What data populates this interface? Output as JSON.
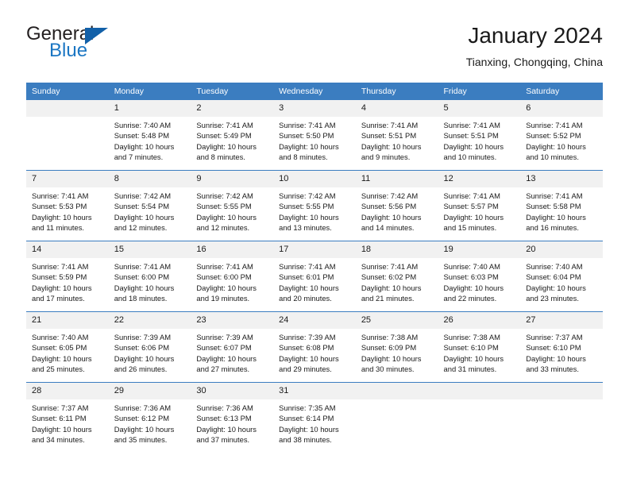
{
  "brand": {
    "name_part1": "General",
    "name_part2": "Blue",
    "triangle_color": "#1260a8",
    "blue_color": "#1b76c3"
  },
  "header": {
    "title": "January 2024",
    "subtitle": "Tianxing, Chongqing, China"
  },
  "theme": {
    "header_bg": "#3b7dc0",
    "header_text": "#ffffff",
    "daynum_bg": "#f1f1f1",
    "grid_line": "#3b7dc0",
    "body_text": "#1a1a1a"
  },
  "weekdays": [
    "Sunday",
    "Monday",
    "Tuesday",
    "Wednesday",
    "Thursday",
    "Friday",
    "Saturday"
  ],
  "weeks": [
    [
      {
        "day": "",
        "sunrise": "",
        "sunset": "",
        "daylight_line1": "",
        "daylight_line2": "",
        "empty": true
      },
      {
        "day": "1",
        "sunrise": "Sunrise: 7:40 AM",
        "sunset": "Sunset: 5:48 PM",
        "daylight_line1": "Daylight: 10 hours",
        "daylight_line2": "and 7 minutes."
      },
      {
        "day": "2",
        "sunrise": "Sunrise: 7:41 AM",
        "sunset": "Sunset: 5:49 PM",
        "daylight_line1": "Daylight: 10 hours",
        "daylight_line2": "and 8 minutes."
      },
      {
        "day": "3",
        "sunrise": "Sunrise: 7:41 AM",
        "sunset": "Sunset: 5:50 PM",
        "daylight_line1": "Daylight: 10 hours",
        "daylight_line2": "and 8 minutes."
      },
      {
        "day": "4",
        "sunrise": "Sunrise: 7:41 AM",
        "sunset": "Sunset: 5:51 PM",
        "daylight_line1": "Daylight: 10 hours",
        "daylight_line2": "and 9 minutes."
      },
      {
        "day": "5",
        "sunrise": "Sunrise: 7:41 AM",
        "sunset": "Sunset: 5:51 PM",
        "daylight_line1": "Daylight: 10 hours",
        "daylight_line2": "and 10 minutes."
      },
      {
        "day": "6",
        "sunrise": "Sunrise: 7:41 AM",
        "sunset": "Sunset: 5:52 PM",
        "daylight_line1": "Daylight: 10 hours",
        "daylight_line2": "and 10 minutes."
      }
    ],
    [
      {
        "day": "7",
        "sunrise": "Sunrise: 7:41 AM",
        "sunset": "Sunset: 5:53 PM",
        "daylight_line1": "Daylight: 10 hours",
        "daylight_line2": "and 11 minutes."
      },
      {
        "day": "8",
        "sunrise": "Sunrise: 7:42 AM",
        "sunset": "Sunset: 5:54 PM",
        "daylight_line1": "Daylight: 10 hours",
        "daylight_line2": "and 12 minutes."
      },
      {
        "day": "9",
        "sunrise": "Sunrise: 7:42 AM",
        "sunset": "Sunset: 5:55 PM",
        "daylight_line1": "Daylight: 10 hours",
        "daylight_line2": "and 12 minutes."
      },
      {
        "day": "10",
        "sunrise": "Sunrise: 7:42 AM",
        "sunset": "Sunset: 5:55 PM",
        "daylight_line1": "Daylight: 10 hours",
        "daylight_line2": "and 13 minutes."
      },
      {
        "day": "11",
        "sunrise": "Sunrise: 7:42 AM",
        "sunset": "Sunset: 5:56 PM",
        "daylight_line1": "Daylight: 10 hours",
        "daylight_line2": "and 14 minutes."
      },
      {
        "day": "12",
        "sunrise": "Sunrise: 7:41 AM",
        "sunset": "Sunset: 5:57 PM",
        "daylight_line1": "Daylight: 10 hours",
        "daylight_line2": "and 15 minutes."
      },
      {
        "day": "13",
        "sunrise": "Sunrise: 7:41 AM",
        "sunset": "Sunset: 5:58 PM",
        "daylight_line1": "Daylight: 10 hours",
        "daylight_line2": "and 16 minutes."
      }
    ],
    [
      {
        "day": "14",
        "sunrise": "Sunrise: 7:41 AM",
        "sunset": "Sunset: 5:59 PM",
        "daylight_line1": "Daylight: 10 hours",
        "daylight_line2": "and 17 minutes."
      },
      {
        "day": "15",
        "sunrise": "Sunrise: 7:41 AM",
        "sunset": "Sunset: 6:00 PM",
        "daylight_line1": "Daylight: 10 hours",
        "daylight_line2": "and 18 minutes."
      },
      {
        "day": "16",
        "sunrise": "Sunrise: 7:41 AM",
        "sunset": "Sunset: 6:00 PM",
        "daylight_line1": "Daylight: 10 hours",
        "daylight_line2": "and 19 minutes."
      },
      {
        "day": "17",
        "sunrise": "Sunrise: 7:41 AM",
        "sunset": "Sunset: 6:01 PM",
        "daylight_line1": "Daylight: 10 hours",
        "daylight_line2": "and 20 minutes."
      },
      {
        "day": "18",
        "sunrise": "Sunrise: 7:41 AM",
        "sunset": "Sunset: 6:02 PM",
        "daylight_line1": "Daylight: 10 hours",
        "daylight_line2": "and 21 minutes."
      },
      {
        "day": "19",
        "sunrise": "Sunrise: 7:40 AM",
        "sunset": "Sunset: 6:03 PM",
        "daylight_line1": "Daylight: 10 hours",
        "daylight_line2": "and 22 minutes."
      },
      {
        "day": "20",
        "sunrise": "Sunrise: 7:40 AM",
        "sunset": "Sunset: 6:04 PM",
        "daylight_line1": "Daylight: 10 hours",
        "daylight_line2": "and 23 minutes."
      }
    ],
    [
      {
        "day": "21",
        "sunrise": "Sunrise: 7:40 AM",
        "sunset": "Sunset: 6:05 PM",
        "daylight_line1": "Daylight: 10 hours",
        "daylight_line2": "and 25 minutes."
      },
      {
        "day": "22",
        "sunrise": "Sunrise: 7:39 AM",
        "sunset": "Sunset: 6:06 PM",
        "daylight_line1": "Daylight: 10 hours",
        "daylight_line2": "and 26 minutes."
      },
      {
        "day": "23",
        "sunrise": "Sunrise: 7:39 AM",
        "sunset": "Sunset: 6:07 PM",
        "daylight_line1": "Daylight: 10 hours",
        "daylight_line2": "and 27 minutes."
      },
      {
        "day": "24",
        "sunrise": "Sunrise: 7:39 AM",
        "sunset": "Sunset: 6:08 PM",
        "daylight_line1": "Daylight: 10 hours",
        "daylight_line2": "and 29 minutes."
      },
      {
        "day": "25",
        "sunrise": "Sunrise: 7:38 AM",
        "sunset": "Sunset: 6:09 PM",
        "daylight_line1": "Daylight: 10 hours",
        "daylight_line2": "and 30 minutes."
      },
      {
        "day": "26",
        "sunrise": "Sunrise: 7:38 AM",
        "sunset": "Sunset: 6:10 PM",
        "daylight_line1": "Daylight: 10 hours",
        "daylight_line2": "and 31 minutes."
      },
      {
        "day": "27",
        "sunrise": "Sunrise: 7:37 AM",
        "sunset": "Sunset: 6:10 PM",
        "daylight_line1": "Daylight: 10 hours",
        "daylight_line2": "and 33 minutes."
      }
    ],
    [
      {
        "day": "28",
        "sunrise": "Sunrise: 7:37 AM",
        "sunset": "Sunset: 6:11 PM",
        "daylight_line1": "Daylight: 10 hours",
        "daylight_line2": "and 34 minutes."
      },
      {
        "day": "29",
        "sunrise": "Sunrise: 7:36 AM",
        "sunset": "Sunset: 6:12 PM",
        "daylight_line1": "Daylight: 10 hours",
        "daylight_line2": "and 35 minutes."
      },
      {
        "day": "30",
        "sunrise": "Sunrise: 7:36 AM",
        "sunset": "Sunset: 6:13 PM",
        "daylight_line1": "Daylight: 10 hours",
        "daylight_line2": "and 37 minutes."
      },
      {
        "day": "31",
        "sunrise": "Sunrise: 7:35 AM",
        "sunset": "Sunset: 6:14 PM",
        "daylight_line1": "Daylight: 10 hours",
        "daylight_line2": "and 38 minutes."
      },
      {
        "day": "",
        "sunrise": "",
        "sunset": "",
        "daylight_line1": "",
        "daylight_line2": "",
        "empty": true
      },
      {
        "day": "",
        "sunrise": "",
        "sunset": "",
        "daylight_line1": "",
        "daylight_line2": "",
        "empty": true
      },
      {
        "day": "",
        "sunrise": "",
        "sunset": "",
        "daylight_line1": "",
        "daylight_line2": "",
        "empty": true
      }
    ]
  ]
}
